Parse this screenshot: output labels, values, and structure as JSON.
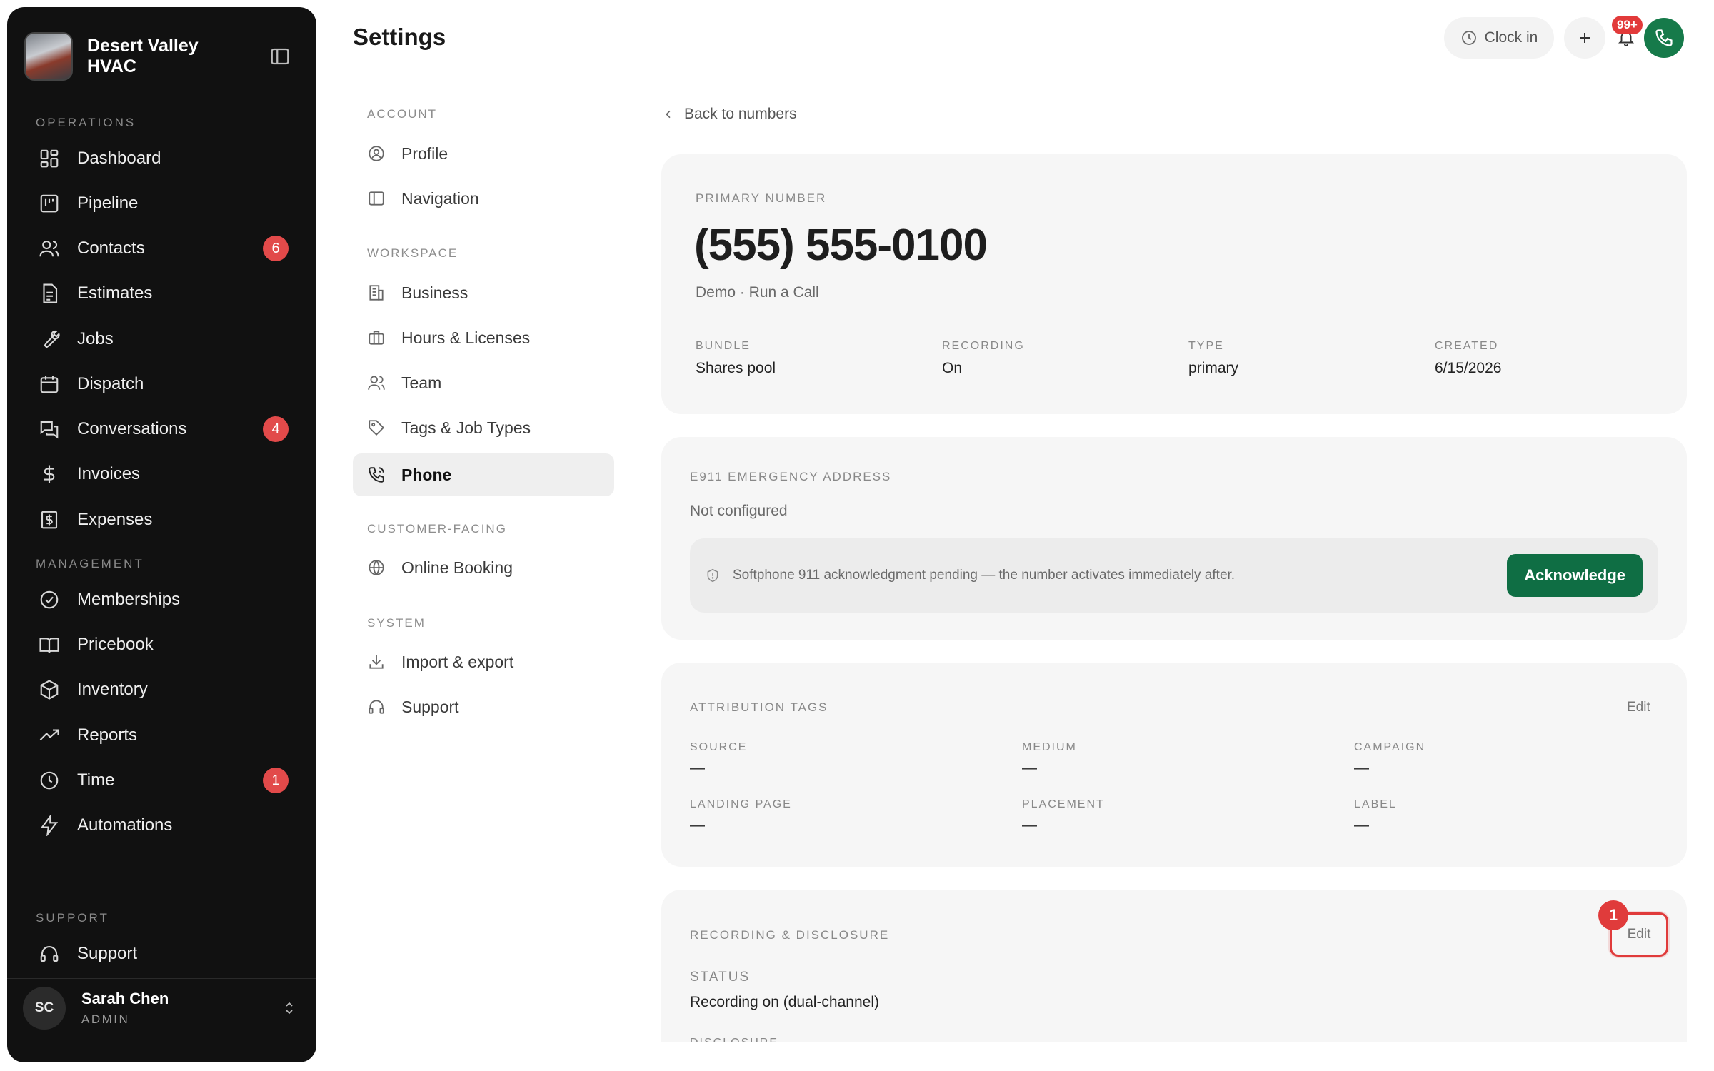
{
  "sidebar": {
    "brand_name": "Desert Valley HVAC",
    "sections": {
      "operations": "OPERATIONS",
      "management": "MANAGEMENT",
      "support": "SUPPORT"
    },
    "items": [
      {
        "label": "Dashboard",
        "icon": "dashboard-icon"
      },
      {
        "label": "Pipeline",
        "icon": "pipeline-icon"
      },
      {
        "label": "Contacts",
        "icon": "contacts-icon",
        "badge": "6"
      },
      {
        "label": "Estimates",
        "icon": "estimates-icon"
      },
      {
        "label": "Jobs",
        "icon": "wrench-icon"
      },
      {
        "label": "Dispatch",
        "icon": "calendar-icon"
      },
      {
        "label": "Conversations",
        "icon": "chat-icon",
        "badge": "4"
      },
      {
        "label": "Invoices",
        "icon": "dollar-icon"
      },
      {
        "label": "Expenses",
        "icon": "receipt-icon"
      },
      {
        "label": "Memberships",
        "icon": "badge-check-icon"
      },
      {
        "label": "Pricebook",
        "icon": "book-icon"
      },
      {
        "label": "Inventory",
        "icon": "box-icon"
      },
      {
        "label": "Reports",
        "icon": "trend-icon"
      },
      {
        "label": "Time",
        "icon": "clock-icon",
        "badge": "1"
      },
      {
        "label": "Automations",
        "icon": "bolt-icon"
      },
      {
        "label": "Support",
        "icon": "headset-icon"
      }
    ],
    "user": {
      "initials": "SC",
      "name": "Sarah Chen",
      "role": "ADMIN"
    }
  },
  "header": {
    "title": "Settings",
    "clock_in": "Clock in",
    "notification_count": "99+"
  },
  "settings_nav": {
    "sections": {
      "account": "ACCOUNT",
      "workspace": "WORKSPACE",
      "customer": "CUSTOMER-FACING",
      "system": "SYSTEM"
    },
    "items": [
      {
        "label": "Profile"
      },
      {
        "label": "Navigation"
      },
      {
        "label": "Business"
      },
      {
        "label": "Hours & Licenses"
      },
      {
        "label": "Team"
      },
      {
        "label": "Tags & Job Types"
      },
      {
        "label": "Phone"
      },
      {
        "label": "Online Booking"
      },
      {
        "label": "Import & export"
      },
      {
        "label": "Support"
      }
    ],
    "active": "Phone"
  },
  "main": {
    "back_label": "Back to numbers",
    "primary": {
      "label": "PRIMARY NUMBER",
      "number": "(555) 555-0100",
      "subtitle": "Demo · Run a Call",
      "fields": [
        {
          "label": "BUNDLE",
          "value": "Shares pool"
        },
        {
          "label": "RECORDING",
          "value": "On"
        },
        {
          "label": "TYPE",
          "value": "primary"
        },
        {
          "label": "CREATED",
          "value": "6/15/2026"
        }
      ]
    },
    "e911": {
      "label": "E911 EMERGENCY ADDRESS",
      "status": "Not configured",
      "notice": "Softphone 911 acknowledgment pending — the number activates immediately after.",
      "button": "Acknowledge"
    },
    "attribution": {
      "label": "ATTRIBUTION TAGS",
      "edit": "Edit",
      "fields": [
        {
          "label": "SOURCE",
          "value": "—"
        },
        {
          "label": "MEDIUM",
          "value": "—"
        },
        {
          "label": "CAMPAIGN",
          "value": "—"
        },
        {
          "label": "LANDING PAGE",
          "value": "—"
        },
        {
          "label": "PLACEMENT",
          "value": "—"
        },
        {
          "label": "LABEL",
          "value": "—"
        }
      ]
    },
    "recording": {
      "label": "RECORDING & DISCLOSURE",
      "edit": "Edit",
      "marker": "1",
      "status_label": "STATUS",
      "status_value": "Recording on (dual-channel)",
      "disclosure_label": "DISCLOSURE"
    }
  },
  "colors": {
    "sidebar_bg": "#111111",
    "badge": "#e24a4a",
    "accent_green": "#0f6e44",
    "card_bg": "#f6f6f6",
    "highlight_red": "#e03b3b"
  }
}
